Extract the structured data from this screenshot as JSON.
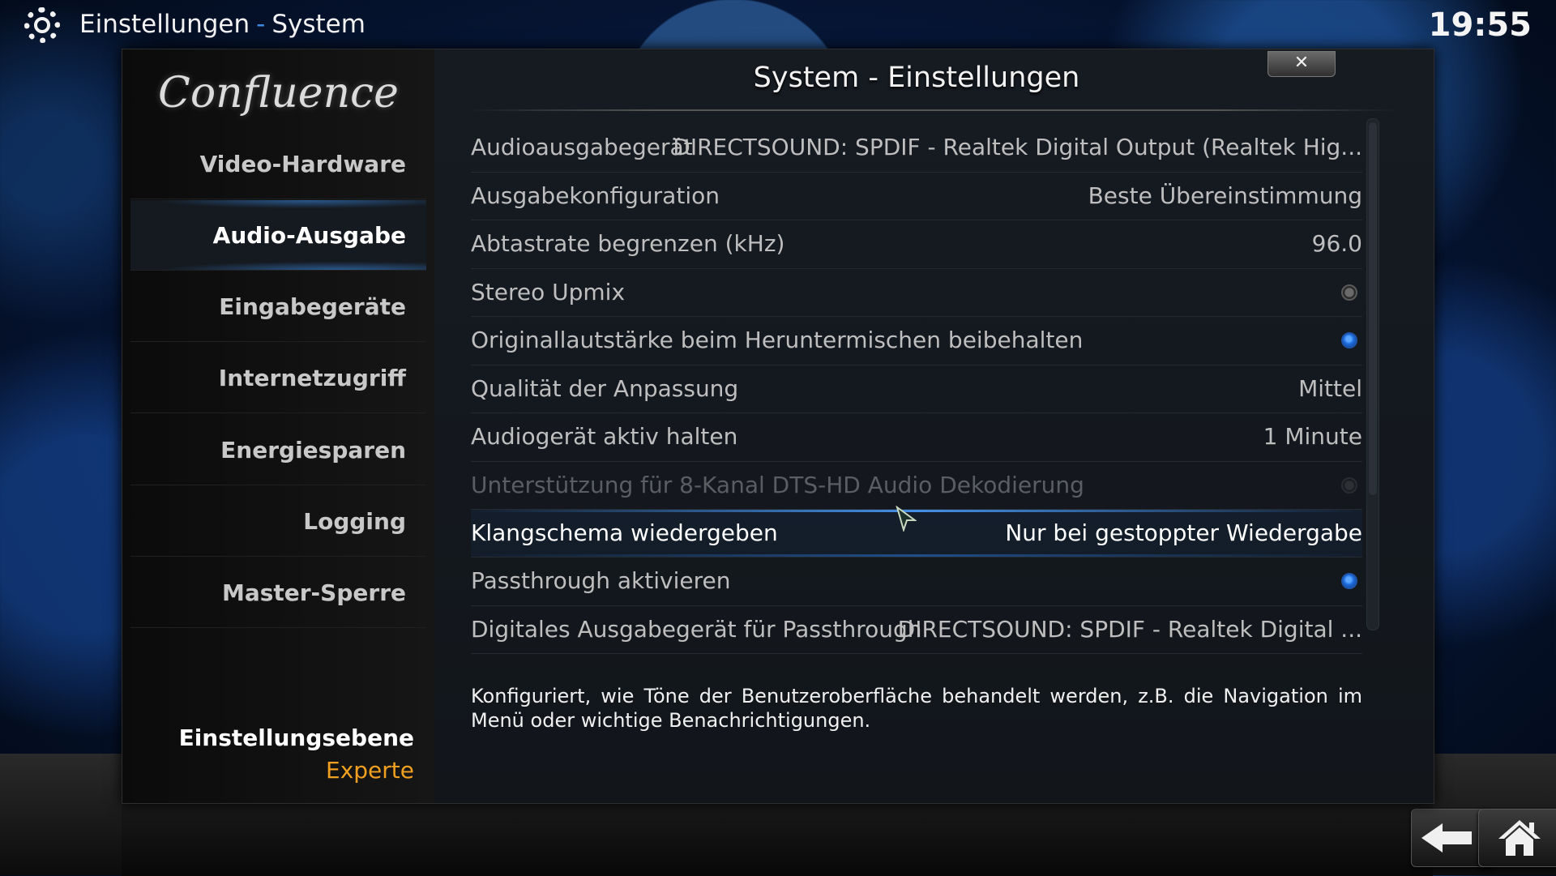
{
  "header": {
    "section": "Einstellungen",
    "separator": "-",
    "page": "System",
    "clock": "19:55",
    "icon": "gear-icon"
  },
  "dialog": {
    "title": "System - Einstellungen",
    "close_glyph": "✕",
    "logo_text": "Confluence"
  },
  "sidebar": {
    "items": [
      {
        "label": "Video-Hardware"
      },
      {
        "label": "Audio-Ausgabe"
      },
      {
        "label": "Eingabegeräte"
      },
      {
        "label": "Internetzugriff"
      },
      {
        "label": "Energiesparen"
      },
      {
        "label": "Logging"
      },
      {
        "label": "Master-Sperre"
      }
    ],
    "active_item": "Audio-Ausgabe",
    "level_label": "Einstellungsebene",
    "level_value": "Experte"
  },
  "settings": [
    {
      "label": "Audioausgabegerät",
      "value": "DIRECTSOUND: SPDIF - Realtek Digital Output (Realtek Hig..."
    },
    {
      "label": "Ausgabekonfiguration",
      "value": "Beste Übereinstimmung"
    },
    {
      "label": "Abtastrate begrenzen (kHz)",
      "value": "96.0"
    },
    {
      "label": "Stereo Upmix",
      "toggle": false
    },
    {
      "label": "Originallautstärke beim Heruntermischen beibehalten",
      "toggle": true
    },
    {
      "label": "Qualität der Anpassung",
      "value": "Mittel"
    },
    {
      "label": "Audiogerät aktiv halten",
      "value": "1 Minute"
    },
    {
      "label": "Unterstützung für 8-Kanal DTS-HD Audio Dekodierung",
      "toggle": false,
      "disabled": true
    },
    {
      "label": "Klangschema wiedergeben",
      "value": "Nur bei gestoppter Wiedergabe",
      "focused": true
    },
    {
      "label": "Passthrough aktivieren",
      "toggle": true
    },
    {
      "label": "Digitales Ausgabegerät für Passthrough",
      "value": "DIRECTSOUND: SPDIF - Realtek Digital ..."
    }
  ],
  "description": "Konfiguriert, wie Töne der Benutzeroberfläche behandelt werden, z.B. die Navigation im Menü oder wichtige Benachrichtigungen.",
  "footer": {
    "back_icon": "back-arrow-icon",
    "home_icon": "home-icon"
  },
  "colors": {
    "accent": "#3a8be0",
    "level_value": "#f0a020",
    "toggle_on": "#1f6ee0"
  }
}
